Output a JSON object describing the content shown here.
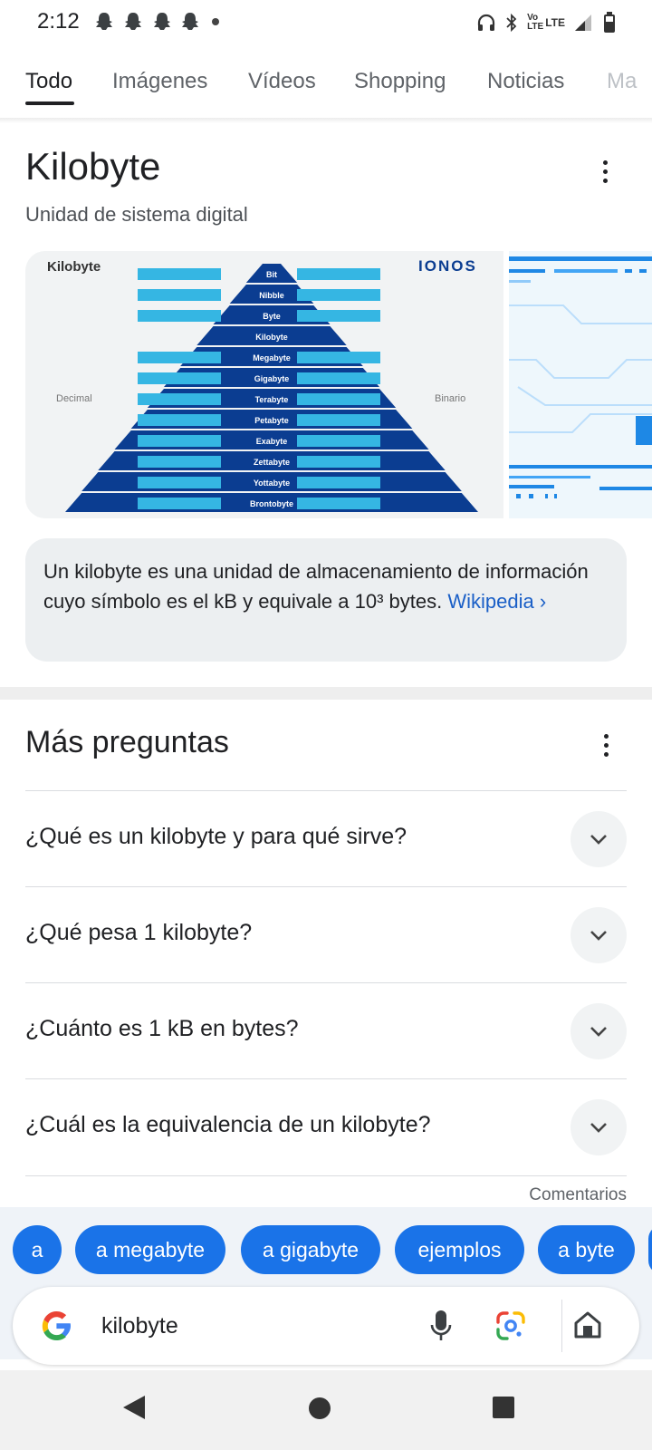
{
  "status_bar": {
    "time": "2:12",
    "network_label_top": "Vo",
    "network_label_bottom": "LTE",
    "network_type": "LTE"
  },
  "tabs": [
    {
      "label": "Todo"
    },
    {
      "label": "Imágenes"
    },
    {
      "label": "Vídeos"
    },
    {
      "label": "Shopping"
    },
    {
      "label": "Noticias"
    },
    {
      "label": "Ma"
    }
  ],
  "knowledge_panel": {
    "title": "Kilobyte",
    "subtitle": "Unidad de sistema digital",
    "image": {
      "heading": "Kilobyte",
      "brand": "IONOS",
      "left_label": "Decimal",
      "right_label": "Binario",
      "pyramid_levels": [
        "Bit",
        "Nibble",
        "Byte",
        "Kilobyte",
        "Megabyte",
        "Gigabyte",
        "Terabyte",
        "Petabyte",
        "Exabyte",
        "Zettabyte",
        "Yottabyte",
        "Brontobyte"
      ]
    },
    "description": "Un kilobyte es una unidad de almacenamiento de información cuyo símbolo es el kB y equivale a 10³ bytes.",
    "source_link": "Wikipedia",
    "source_chevron": "›"
  },
  "paa": {
    "title": "Más preguntas",
    "questions": [
      "¿Qué es un kilobyte y para qué sirve?",
      "¿Qué pesa 1 kilobyte?",
      "¿Cuánto es 1 kB en bytes?",
      "¿Cuál es la equivalencia de un kilobyte?"
    ],
    "feedback": "Comentarios"
  },
  "suggestion_chips": [
    "a",
    "a megabyte",
    "a gigabyte",
    "ejemplos",
    "a byte"
  ],
  "search": {
    "value": "kilobyte"
  },
  "colors": {
    "accent": "#1a73e8",
    "pyramid_dark": "#0b3d91",
    "pyramid_label_bg": "#35b6e3",
    "link": "#1a5fc7"
  },
  "icons": {
    "status": [
      "snapchat-ghost-icon",
      "headphones-icon",
      "bluetooth-icon",
      "signal-icon",
      "battery-icon"
    ],
    "search_bar": [
      "google-logo-icon",
      "microphone-icon",
      "google-lens-icon",
      "home-icon"
    ],
    "navigation": [
      "back-icon",
      "home-circle-icon",
      "recents-icon"
    ]
  }
}
